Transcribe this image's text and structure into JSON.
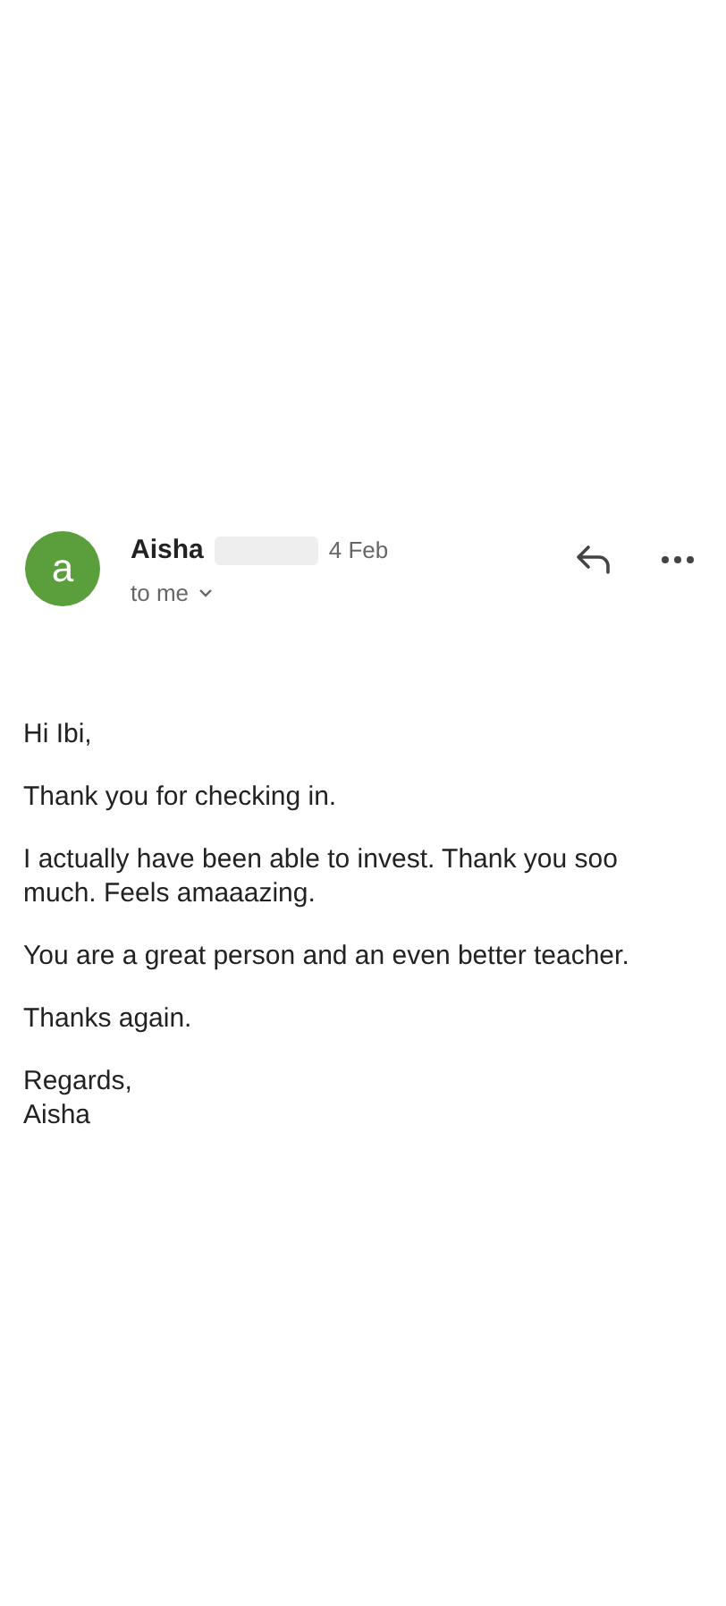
{
  "message": {
    "sender": "Aisha",
    "date": "4 Feb",
    "recipient": "to me",
    "avatar_letter": "a",
    "body": [
      "Hi Ibi,",
      "Thank you for checking in.",
      "I actually have been able to invest. Thank you soo much. Feels amaaazing.",
      "You are a great person and an even better teacher.",
      "Thanks again.",
      "Regards,\nAisha"
    ]
  }
}
